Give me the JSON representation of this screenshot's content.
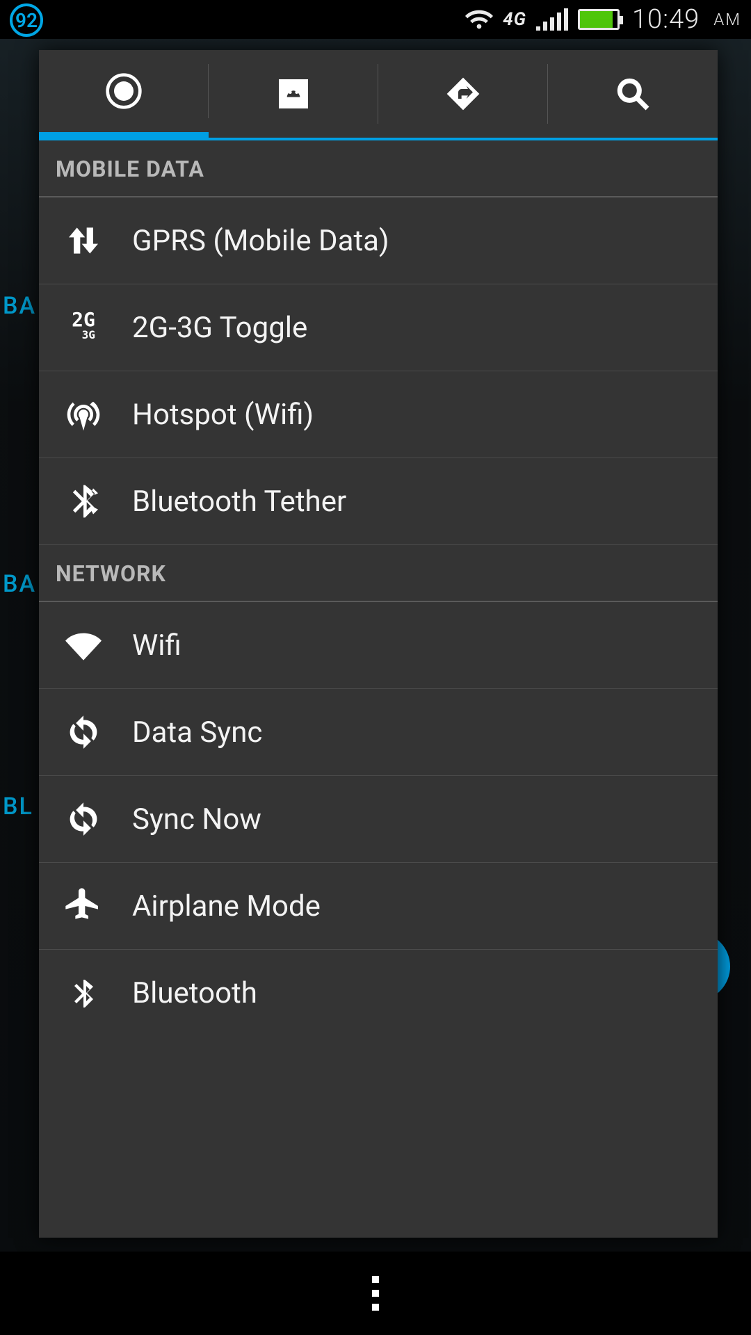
{
  "status_bar": {
    "battery_pct": "92",
    "network_label": "4G",
    "time": "10:49",
    "time_suffix": "AM"
  },
  "background": {
    "label_a": "BA",
    "label_b": "BA",
    "label_c": "BL"
  },
  "panel": {
    "tabs": [
      {
        "name": "power",
        "active": true
      },
      {
        "name": "apps",
        "active": false
      },
      {
        "name": "navigate",
        "active": false
      },
      {
        "name": "search",
        "active": false
      }
    ],
    "sections": [
      {
        "header": "MOBILE DATA",
        "items": [
          {
            "icon": "data-arrows",
            "label": "GPRS (Mobile Data)"
          },
          {
            "icon": "2g3g",
            "label": "2G-3G Toggle"
          },
          {
            "icon": "hotspot",
            "label": "Hotspot (Wifi)"
          },
          {
            "icon": "bt-tether",
            "label": "Bluetooth Tether"
          }
        ]
      },
      {
        "header": "NETWORK",
        "items": [
          {
            "icon": "wifi",
            "label": "Wifi"
          },
          {
            "icon": "sync",
            "label": "Data Sync"
          },
          {
            "icon": "sync",
            "label": "Sync Now"
          },
          {
            "icon": "airplane",
            "label": "Airplane Mode"
          },
          {
            "icon": "bluetooth",
            "label": "Bluetooth"
          }
        ]
      }
    ]
  },
  "icon_labels": {
    "2g_main": "2G",
    "2g_sub": "3G"
  }
}
